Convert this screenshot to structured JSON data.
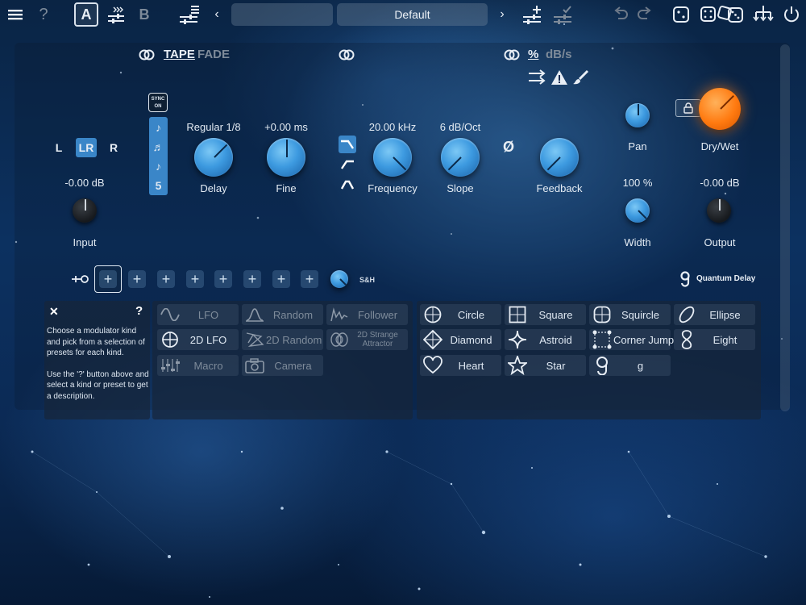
{
  "topbar": {
    "menu_icon": "hamburger-icon",
    "help_icon": "question-icon",
    "ab_a": "A",
    "ab_b": "B",
    "preset_name": "Default"
  },
  "routing": {
    "tape": "TAPE",
    "fade": "FADE",
    "percent": "%",
    "dbs": "dB/s"
  },
  "input": {
    "channels": [
      "L",
      "LR",
      "R"
    ],
    "selected": "LR",
    "value": "-0.00 dB",
    "label": "Input"
  },
  "sync": {
    "line1": "SYNC",
    "line2": "ON",
    "notes": [
      "♪",
      "♬",
      "♪",
      "5"
    ]
  },
  "delay": {
    "value": "Regular 1/8",
    "label": "Delay"
  },
  "fine": {
    "value": "+0.00 ms",
    "label": "Fine"
  },
  "frequency": {
    "value": "20.00 kHz",
    "label": "Frequency"
  },
  "slope": {
    "value": "6 dB/Oct",
    "label": "Slope"
  },
  "feedback": {
    "phase": "Ø",
    "label": "Feedback"
  },
  "pan": {
    "label": "Pan"
  },
  "drywet": {
    "label": "Dry/Wet"
  },
  "width": {
    "value": "100 %",
    "label": "Width"
  },
  "output": {
    "value": "-0.00 dB",
    "label": "Output"
  },
  "modslots": {
    "sh": "S&H"
  },
  "brand": {
    "name": "Quantum Delay",
    "logo": "g"
  },
  "info": {
    "close": "✕",
    "help": "?",
    "text1": "Choose a modulator kind and pick from a selection of presets for each kind.",
    "text2": "Use the '?' button above and select a kind or preset to get a description."
  },
  "kinds": [
    {
      "label": "LFO",
      "icon": "sine-wave-icon",
      "dim": true
    },
    {
      "label": "Random",
      "icon": "random-icon",
      "dim": true
    },
    {
      "label": "Follower",
      "icon": "follower-icon",
      "dim": true
    },
    {
      "label": "2D LFO",
      "icon": "circle-cross-icon",
      "dim": false
    },
    {
      "label": "2D Random",
      "icon": "2d-random-icon",
      "dim": true
    },
    {
      "label": "2D Strange Attractor",
      "icon": "attractor-icon",
      "dim": true
    },
    {
      "label": "Macro",
      "icon": "macro-icon",
      "dim": true
    },
    {
      "label": "Camera",
      "icon": "camera-icon",
      "dim": true
    }
  ],
  "presets": [
    {
      "label": "Circle",
      "icon": "circle-icon"
    },
    {
      "label": "Square",
      "icon": "square-icon"
    },
    {
      "label": "Squircle",
      "icon": "squircle-icon"
    },
    {
      "label": "Ellipse",
      "icon": "ellipse-icon"
    },
    {
      "label": "Diamond",
      "icon": "diamond-icon"
    },
    {
      "label": "Astroid",
      "icon": "astroid-icon"
    },
    {
      "label": "Corner Jump",
      "icon": "corner-jump-icon"
    },
    {
      "label": "Eight",
      "icon": "eight-icon"
    },
    {
      "label": "Heart",
      "icon": "heart-icon"
    },
    {
      "label": "Star",
      "icon": "star-icon"
    },
    {
      "label": "g",
      "icon": "g-icon"
    }
  ],
  "colors": {
    "accent": "#3a86c8",
    "knob_orange": "#ff7a10"
  }
}
